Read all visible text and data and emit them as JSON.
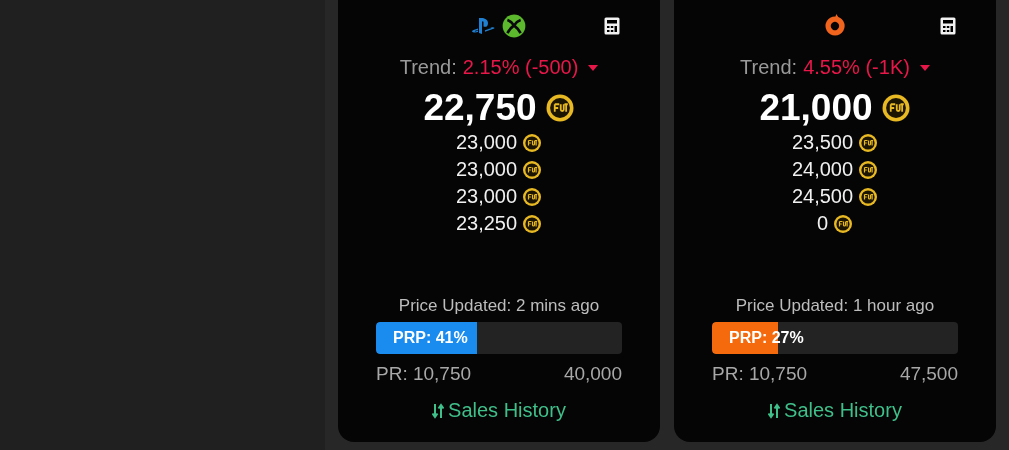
{
  "cards": [
    {
      "kind": "ps_xbox",
      "trend_label": "Trend:",
      "trend_value": "2.15% (-500)",
      "price": "22,750",
      "other_prices": [
        "23,000",
        "23,000",
        "23,000",
        "23,250"
      ],
      "updated": "Price Updated: 2 mins ago",
      "prp": "PRP: 41%",
      "level": 0.41,
      "color": "#1a8cf0",
      "pr": "PR: 10,750",
      "max": "40,000",
      "history": "Sales History"
    },
    {
      "kind": "origin",
      "trend_label": "Trend:",
      "trend_value": "4.55% (-1K)",
      "price": "21,000",
      "other_prices": [
        "23,500",
        "24,000",
        "24,500",
        "0"
      ],
      "updated": "Price Updated: 1 hour ago",
      "prp": "PRP: 27%",
      "level": 0.27,
      "color": "#f46a0c",
      "pr": "PR: 10,750",
      "max": "47,500",
      "history": "Sales History"
    }
  ]
}
